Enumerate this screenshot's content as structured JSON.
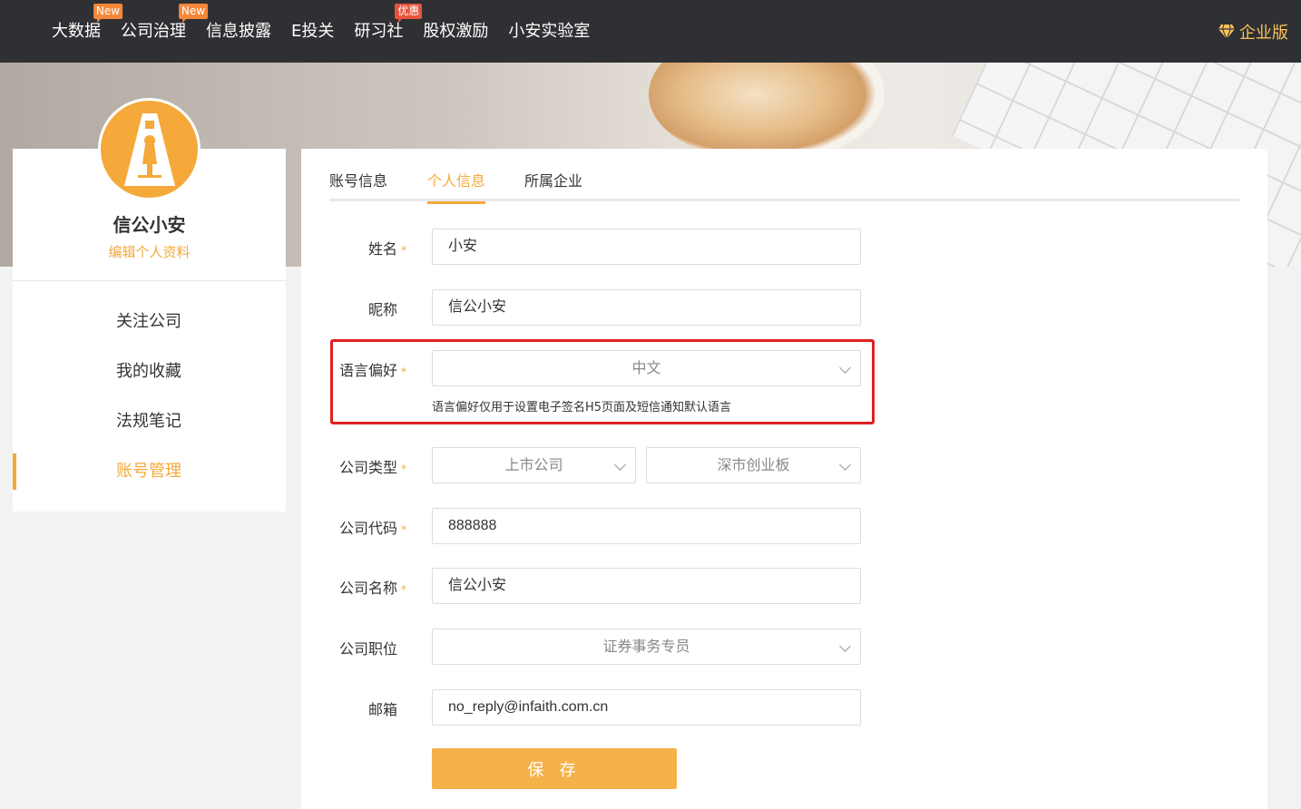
{
  "nav": {
    "items": [
      {
        "label": "大数据",
        "badge": "New"
      },
      {
        "label": "公司治理",
        "badge": "New"
      },
      {
        "label": "信息披露",
        "badge": ""
      },
      {
        "label": "E投关",
        "badge": ""
      },
      {
        "label": "研习社",
        "badge": "优惠"
      },
      {
        "label": "股权激励",
        "badge": ""
      },
      {
        "label": "小安实验室",
        "badge": ""
      }
    ],
    "enterprise_label": "企业版",
    "enterprise_icon": "diamond-icon"
  },
  "profile": {
    "name": "信公小安",
    "edit_label": "编辑个人资料",
    "menu": [
      "关注公司",
      "我的收藏",
      "法规笔记",
      "账号管理"
    ],
    "active_menu": "账号管理"
  },
  "tabs": {
    "items": [
      "账号信息",
      "个人信息",
      "所属企业"
    ],
    "active": "个人信息"
  },
  "form": {
    "name": {
      "label": "姓名",
      "required": "*",
      "value": "小安"
    },
    "nickname": {
      "label": "昵称",
      "value": "信公小安"
    },
    "language": {
      "label": "语言偏好",
      "required": "*",
      "value": "中文",
      "hint": "语言偏好仅用于设置电子签名H5页面及短信通知默认语言"
    },
    "company_type": {
      "label": "公司类型",
      "required": "*",
      "value1": "上市公司",
      "value2": "深市创业板"
    },
    "company_code": {
      "label": "公司代码",
      "required": "*",
      "value": "888888"
    },
    "company_name": {
      "label": "公司名称",
      "required": "*",
      "value": "信公小安"
    },
    "position": {
      "label": "公司职位",
      "value": "证券事务专员"
    },
    "email": {
      "label": "邮箱",
      "value": "no_reply@infaith.com.cn"
    },
    "save_label": "保 存"
  },
  "colors": {
    "accent": "#f5a93a",
    "highlight": "#e02020",
    "topbar": "#2f3033"
  }
}
